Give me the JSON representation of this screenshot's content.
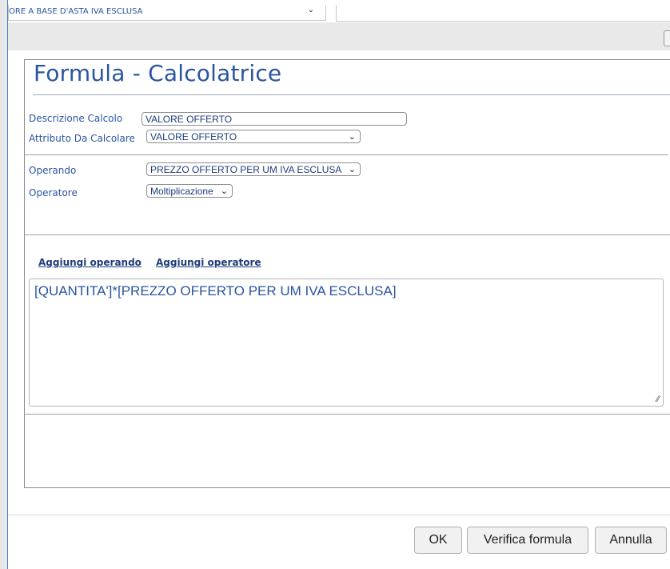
{
  "top": {
    "select_value": "ORE A BASE D'ASTA IVA ESCLUSA"
  },
  "dialog": {
    "title": "Formula - Calcolatrice",
    "descrizione_label": "Descrizione Calcolo",
    "descrizione_value": "VALORE OFFERTO",
    "attributo_label": "Attributo Da Calcolare",
    "attributo_value": "VALORE OFFERTO",
    "operando_label": "Operando",
    "operando_value": "PREZZO OFFERTO PER UM IVA ESCLUSA",
    "operatore_label": "Operatore",
    "operatore_value": "Moltiplicazione",
    "add_operand_link": "Aggiungi operando",
    "add_operator_link": "Aggiungi operatore",
    "formula_text": "[QUANTITA']*[PREZZO OFFERTO PER UM IVA ESCLUSA]"
  },
  "buttons": {
    "ok": "OK",
    "verify": "Verifica formula",
    "cancel": "Annulla"
  },
  "icons": {
    "chevron": "chevron-down-icon",
    "resize": "resize-handle-icon"
  },
  "colors": {
    "accent": "#2a55a0",
    "border": "#8c8c8c"
  }
}
